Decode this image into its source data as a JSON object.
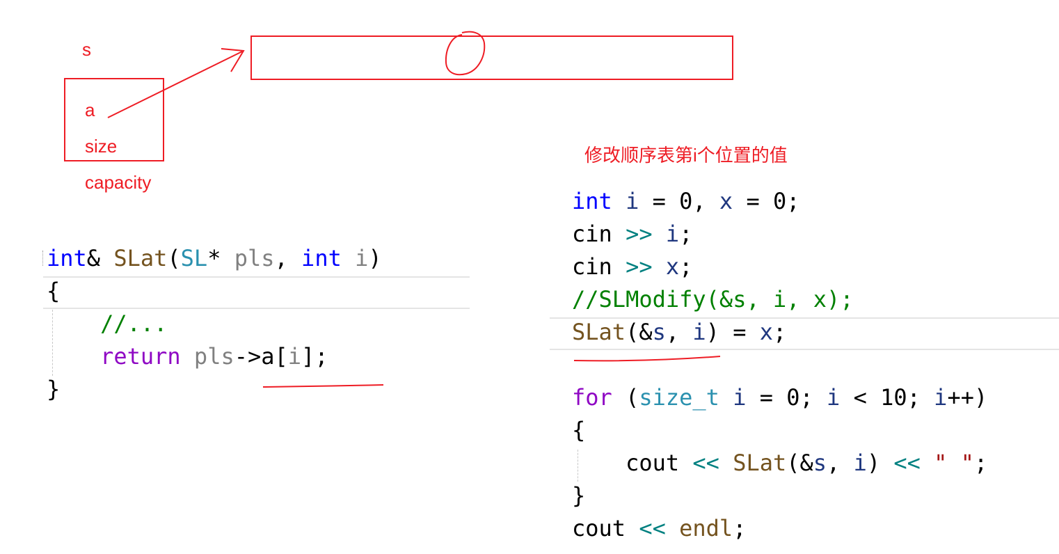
{
  "annotations": {
    "var_s": "s",
    "field_a": "a",
    "field_size": "size",
    "field_capacity": "capacity",
    "title": "修改顺序表第i个位置的值"
  },
  "colors": {
    "annotation": "#ee1c24",
    "keyword": "#0000ff",
    "control": "#8f08c4",
    "type": "#2b91af",
    "function": "#74531f",
    "variable": "#1f377f",
    "param": "#808080",
    "comment": "#008000",
    "operator": "#008080",
    "string": "#a31515"
  },
  "left_code": [
    [
      [
        "int",
        "k"
      ],
      [
        "& ",
        "n"
      ],
      [
        "SLat",
        "f"
      ],
      [
        "(",
        "n"
      ],
      [
        "SL",
        "t"
      ],
      [
        "* ",
        "n"
      ],
      [
        "pls",
        "p"
      ],
      [
        ", ",
        "n"
      ],
      [
        "int",
        "k"
      ],
      [
        " ",
        "n"
      ],
      [
        "i",
        "p"
      ],
      [
        ")",
        "n"
      ]
    ],
    [
      [
        "{",
        "n"
      ]
    ],
    [
      [
        "    ",
        "n"
      ],
      [
        "//...",
        "c"
      ]
    ],
    [
      [
        "    ",
        "n"
      ],
      [
        "return",
        "ctl"
      ],
      [
        " ",
        "n"
      ],
      [
        "pls",
        "p"
      ],
      [
        "->",
        "n"
      ],
      [
        "a",
        "n"
      ],
      [
        "[",
        "n"
      ],
      [
        "i",
        "p"
      ],
      [
        "];",
        "n"
      ]
    ],
    [
      [
        "}",
        "n"
      ]
    ]
  ],
  "right_code": [
    [
      [
        "int",
        "k"
      ],
      [
        " ",
        "n"
      ],
      [
        "i",
        "v"
      ],
      [
        " = ",
        "n"
      ],
      [
        "0",
        "n"
      ],
      [
        ", ",
        "n"
      ],
      [
        "x",
        "v"
      ],
      [
        " = ",
        "n"
      ],
      [
        "0",
        "n"
      ],
      [
        ";",
        "n"
      ]
    ],
    [
      [
        "cin",
        "n"
      ],
      [
        " ",
        "n"
      ],
      [
        ">>",
        "op"
      ],
      [
        " ",
        "n"
      ],
      [
        "i",
        "v"
      ],
      [
        ";",
        "n"
      ]
    ],
    [
      [
        "cin",
        "n"
      ],
      [
        " ",
        "n"
      ],
      [
        ">>",
        "op"
      ],
      [
        " ",
        "n"
      ],
      [
        "x",
        "v"
      ],
      [
        ";",
        "n"
      ]
    ],
    [
      [
        "//SLModify(&s, i, x);",
        "c"
      ]
    ],
    [
      [
        "SLat",
        "f"
      ],
      [
        "(&",
        "n"
      ],
      [
        "s",
        "v"
      ],
      [
        ", ",
        "n"
      ],
      [
        "i",
        "v"
      ],
      [
        ") = ",
        "n"
      ],
      [
        "x",
        "v"
      ],
      [
        ";",
        "n"
      ]
    ],
    [
      [
        "",
        "n"
      ]
    ],
    [
      [
        "for",
        "ctl"
      ],
      [
        " (",
        "n"
      ],
      [
        "size_t",
        "t"
      ],
      [
        " ",
        "n"
      ],
      [
        "i",
        "v"
      ],
      [
        " = ",
        "n"
      ],
      [
        "0",
        "n"
      ],
      [
        "; ",
        "n"
      ],
      [
        "i",
        "v"
      ],
      [
        " < ",
        "n"
      ],
      [
        "10",
        "n"
      ],
      [
        "; ",
        "n"
      ],
      [
        "i",
        "v"
      ],
      [
        "++)",
        "n"
      ]
    ],
    [
      [
        "{",
        "n"
      ]
    ],
    [
      [
        "    ",
        "n"
      ],
      [
        "cout",
        "n"
      ],
      [
        " ",
        "n"
      ],
      [
        "<<",
        "op"
      ],
      [
        " ",
        "n"
      ],
      [
        "SLat",
        "f"
      ],
      [
        "(&",
        "n"
      ],
      [
        "s",
        "v"
      ],
      [
        ", ",
        "n"
      ],
      [
        "i",
        "v"
      ],
      [
        ") ",
        "n"
      ],
      [
        "<<",
        "op"
      ],
      [
        " ",
        "n"
      ],
      [
        "\" \"",
        "s"
      ],
      [
        ";",
        "n"
      ]
    ],
    [
      [
        "}",
        "n"
      ]
    ],
    [
      [
        "cout",
        "n"
      ],
      [
        " ",
        "n"
      ],
      [
        "<<",
        "op"
      ],
      [
        " ",
        "n"
      ],
      [
        "endl",
        "f"
      ],
      [
        ";",
        "n"
      ]
    ]
  ]
}
